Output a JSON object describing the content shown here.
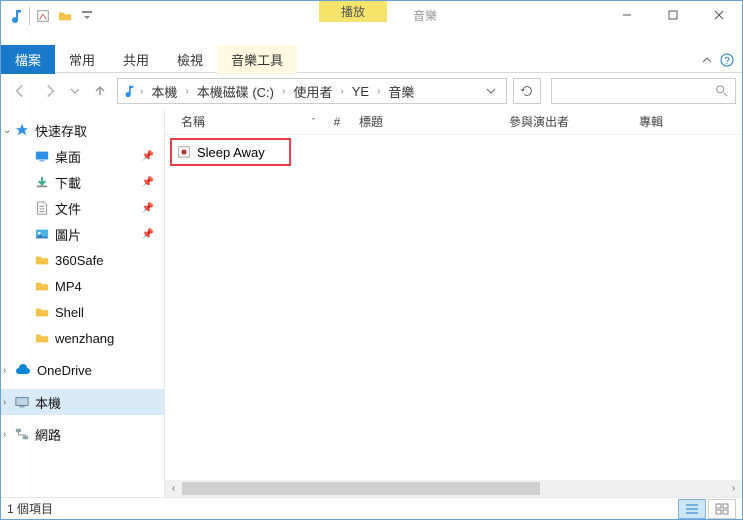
{
  "title": {
    "context_play": "播放",
    "context_sub": "音樂"
  },
  "ribbon": {
    "file": "檔案",
    "home": "常用",
    "share": "共用",
    "view": "檢視",
    "music_tools": "音樂工具"
  },
  "breadcrumbs": {
    "pc": "本機",
    "drive": "本機磁碟 (C:)",
    "users": "使用者",
    "user": "YE",
    "music": "音樂"
  },
  "columns": {
    "name": "名稱",
    "num": "#",
    "title": "標題",
    "artist": "參與演出者",
    "album": "專輯"
  },
  "sidebar": {
    "quick_access": "快速存取",
    "desktop": "桌面",
    "downloads": "下載",
    "documents": "文件",
    "pictures": "圖片",
    "safe360": "360Safe",
    "mp4": "MP4",
    "shell": "Shell",
    "wenzhang": "wenzhang",
    "onedrive": "OneDrive",
    "this_pc": "本機",
    "network": "網路"
  },
  "files": {
    "item0": {
      "name": "Sleep Away"
    }
  },
  "status": {
    "count": "1 個項目"
  }
}
